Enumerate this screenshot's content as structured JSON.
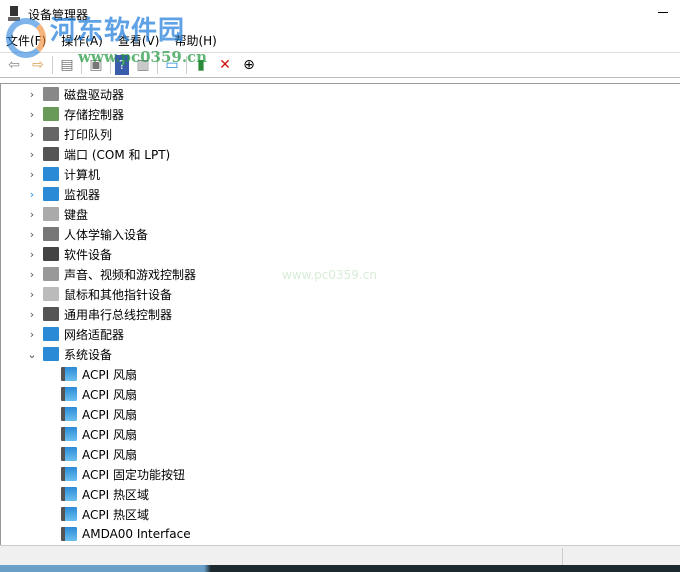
{
  "window": {
    "title": "设备管理器"
  },
  "menu": [
    "文件(F)",
    "操作(A)",
    "查看(V)",
    "帮助(H)"
  ],
  "toolbar": {
    "icons": [
      "back-arrow-icon",
      "forward-arrow-icon",
      "show-hide-console-tree-icon",
      "properties-icon",
      "help-icon",
      "action-pane-icon",
      "scan-hardware-icon",
      "update-driver-icon",
      "uninstall-icon",
      "disable-device-icon"
    ]
  },
  "tree": {
    "categories": [
      {
        "label": "磁盘驱动器",
        "icon": "disk-drive-icon"
      },
      {
        "label": "存储控制器",
        "icon": "storage-controller-icon"
      },
      {
        "label": "打印队列",
        "icon": "printer-icon"
      },
      {
        "label": "端口 (COM 和 LPT)",
        "icon": "port-icon"
      },
      {
        "label": "计算机",
        "icon": "computer-icon"
      },
      {
        "label": "监视器",
        "icon": "monitor-icon"
      },
      {
        "label": "键盘",
        "icon": "keyboard-icon"
      },
      {
        "label": "人体学输入设备",
        "icon": "hid-icon"
      },
      {
        "label": "软件设备",
        "icon": "software-device-icon"
      },
      {
        "label": "声音、视频和游戏控制器",
        "icon": "speaker-icon"
      },
      {
        "label": "鼠标和其他指针设备",
        "icon": "mouse-icon"
      },
      {
        "label": "通用串行总线控制器",
        "icon": "usb-icon"
      },
      {
        "label": "网络适配器",
        "icon": "network-adapter-icon"
      },
      {
        "label": "系统设备",
        "icon": "system-device-icon",
        "expanded": true
      }
    ],
    "system_devices": [
      "ACPI 风扇",
      "ACPI 风扇",
      "ACPI 风扇",
      "ACPI 风扇",
      "ACPI 风扇",
      "ACPI 固定功能按钮",
      "ACPI 热区域",
      "ACPI 热区域",
      "AMDA00 Interface"
    ]
  },
  "watermark": {
    "site_name": "河东软件园",
    "url": "www.pc0359.cn"
  }
}
